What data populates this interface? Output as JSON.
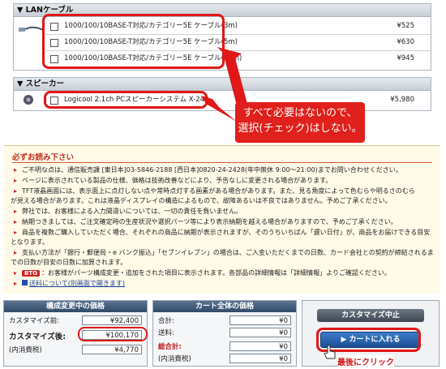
{
  "lan_section": {
    "title": "▼ LANケーブル",
    "items": [
      {
        "name": "1000/100/10BASE-T対応/カテゴリー5E ケーブル(3m)",
        "price": "¥525"
      },
      {
        "name": "1000/100/10BASE-T対応/カテゴリー5E ケーブル(5m)",
        "price": "¥630"
      },
      {
        "name": "1000/100/10BASE-T対応/カテゴリー5E ケーブル(10m)",
        "price": "¥945"
      }
    ]
  },
  "speaker_section": {
    "title": "▼ スピーカー",
    "items": [
      {
        "name": "Logicool 2.1ch PCスピーカーシステム X-240",
        "price": "¥5,980"
      }
    ]
  },
  "annotation_callout": {
    "line1": "すべて必要はないので、",
    "line2": "選択(チェック)はしない。"
  },
  "notice": {
    "title": "必ずお読み下さい",
    "lines": [
      "ご不明な点は、通信販売課 [東日本]03-5846-2188 [西日本]0820-24-2428(年中無休 9:00～21:00)までお問い合わせください。",
      "ページに表示されている製品の仕様、価格は技術改善などにより、予告なしに変更される場合があります。",
      "TFT液晶画面には、表示面上に点灯しない点や常時点灯する画素がある場合があります。また、見る角度によって色むらや明るさのむら",
      "が見える場合があります。これは液晶ディスプレイの構造によるもので、故障あるいは不良ではありません。予めご了承ください。",
      "弊社では、お客様による入力間違いについては、一切の責任を負いません。",
      "納期つきましては、ご注文確定時の生産状況や選択パーツ等により表示納期を越える場合がありますので、予めご了承ください。",
      "商品を複数ご購入していただく場合、それぞれの商品に納期が表示されますが、そのうちいちばん「遅い日付」が、商品をお届けできる目安",
      "となります。",
      "支払い方法が「銀行・郵便局・e バンク振込」「セブンイレブン」の場合は、ご入金いただくまでの日数、カード会社との契約が締結されるま",
      "での日数が目安の日数に加算されます。",
      "：お客様がパーツ構成変更・追加をされた項目に表示されます。各部品の詳細情報は「詳細情報」よりご確認ください。",
      "送料について(別画面で開きます)"
    ],
    "btd_label": "BTO"
  },
  "price_panel": {
    "title": "構成変更中の価格",
    "base_label": "カスタマイズ前:",
    "base_value": "¥92,400",
    "after_label": "カスタマイズ後:",
    "after_value": "¥100,170",
    "tax_label": "(内消費税)",
    "tax_value": "¥4,770"
  },
  "cart_panel": {
    "title": "カート全体の価格",
    "subtotal_label": "合計:",
    "subtotal_value": "¥0",
    "shipping_label": "送料:",
    "shipping_value": "¥0",
    "total_label": "総合計:",
    "total_value": "¥0",
    "tax_label": "(内消費税)",
    "tax_value": "¥0"
  },
  "actions": {
    "cancel_label": "カスタマイズ中止",
    "add_cart_label": "カートに入れる",
    "last_click_label": "最後にクリック"
  },
  "colors": {
    "annotation_red": "#e01818",
    "panel_header": "#3a5675",
    "cart_button": "#2a62ad"
  }
}
